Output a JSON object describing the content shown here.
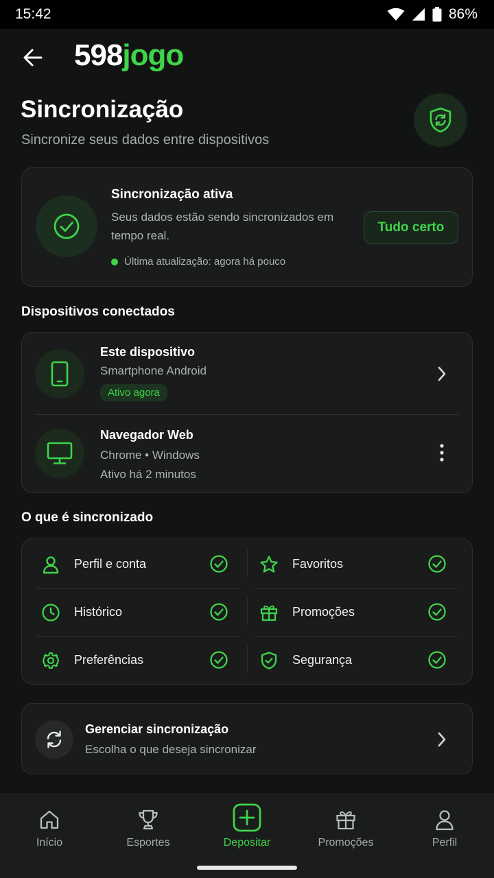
{
  "status_bar": {
    "time": "15:42",
    "battery": "86%"
  },
  "header": {
    "logo_white": "598",
    "logo_green": "jogo"
  },
  "page": {
    "title": "Sincronização",
    "subtitle": "Sincronize seus dados entre dispositivos"
  },
  "sync_status": {
    "title": "Sincronização ativa",
    "description": "Seus dados estão sendo sincronizados em tempo real.",
    "last_update": "Última atualização: agora há pouco",
    "button_label": "Tudo certo"
  },
  "devices": {
    "section_title": "Dispositivos conectados",
    "items": [
      {
        "name": "Este dispositivo",
        "type": "Smartphone Android",
        "status": "Ativo agora",
        "icon": "smartphone-icon"
      },
      {
        "name": "Navegador Web",
        "type": "Chrome • Windows",
        "status": "Ativo há 2 minutos",
        "icon": "monitor-icon"
      }
    ]
  },
  "synced": {
    "section_title": "O que é sincronizado",
    "items": [
      {
        "label": "Perfil e conta",
        "icon": "user-icon"
      },
      {
        "label": "Favoritos",
        "icon": "star-icon"
      },
      {
        "label": "Histórico",
        "icon": "clock-icon"
      },
      {
        "label": "Promoções",
        "icon": "gift-icon"
      },
      {
        "label": "Preferências",
        "icon": "gear-icon"
      },
      {
        "label": "Segurança",
        "icon": "shield-icon"
      }
    ]
  },
  "manage": {
    "title": "Gerenciar sincronização",
    "subtitle": "Escolha o que deseja sincronizar"
  },
  "bottom_nav": {
    "items": [
      {
        "label": "Início",
        "icon": "home-icon"
      },
      {
        "label": "Esportes",
        "icon": "trophy-icon"
      },
      {
        "label": "Depositar",
        "icon": "plus-icon",
        "active": true
      },
      {
        "label": "Promoções",
        "icon": "gift-icon"
      },
      {
        "label": "Perfil",
        "icon": "user-icon"
      }
    ]
  },
  "colors": {
    "accent": "#3fd44a",
    "background": "#121413",
    "card": "#1a1c1b"
  }
}
